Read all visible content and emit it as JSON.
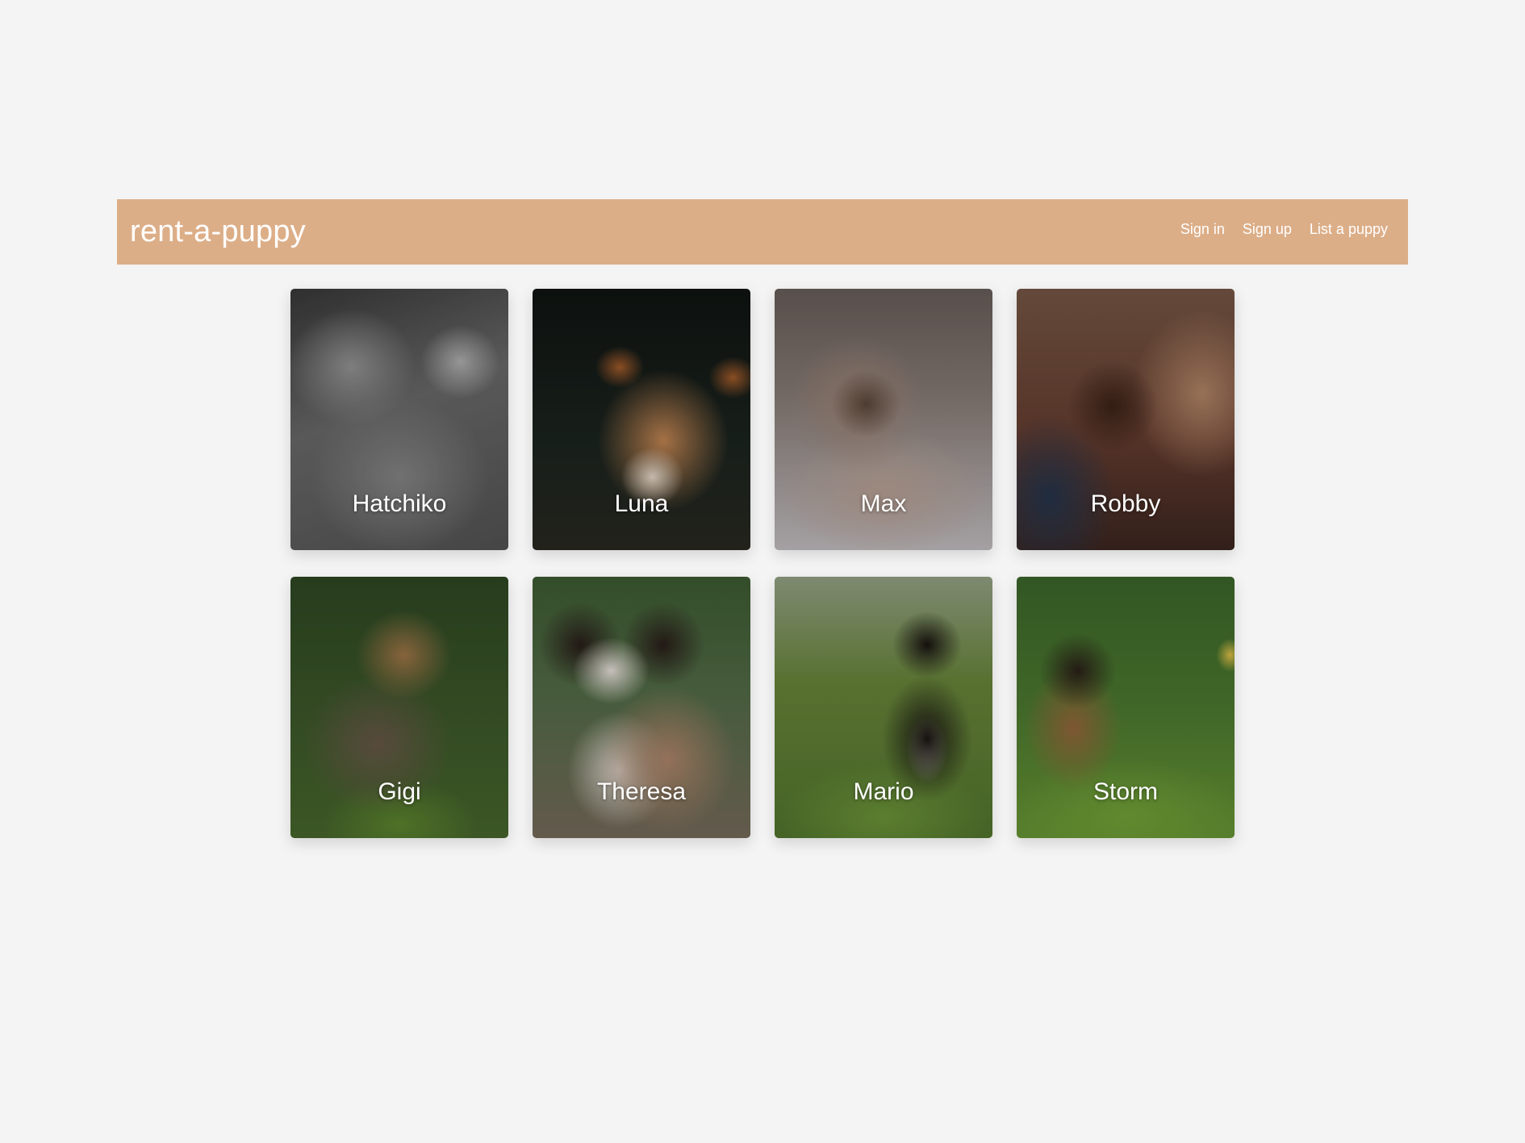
{
  "header": {
    "brand": "rent-a-puppy",
    "nav": [
      "Sign in",
      "Sign up",
      "List a puppy"
    ]
  },
  "puppies": [
    {
      "name": "Hatchiko"
    },
    {
      "name": "Luna"
    },
    {
      "name": "Max"
    },
    {
      "name": "Robby"
    },
    {
      "name": "Gigi"
    },
    {
      "name": "Theresa"
    },
    {
      "name": "Mario"
    },
    {
      "name": "Storm"
    }
  ],
  "colors": {
    "navbar": "#dcae88",
    "background": "#f4f4f4",
    "text": "#ffffff"
  }
}
